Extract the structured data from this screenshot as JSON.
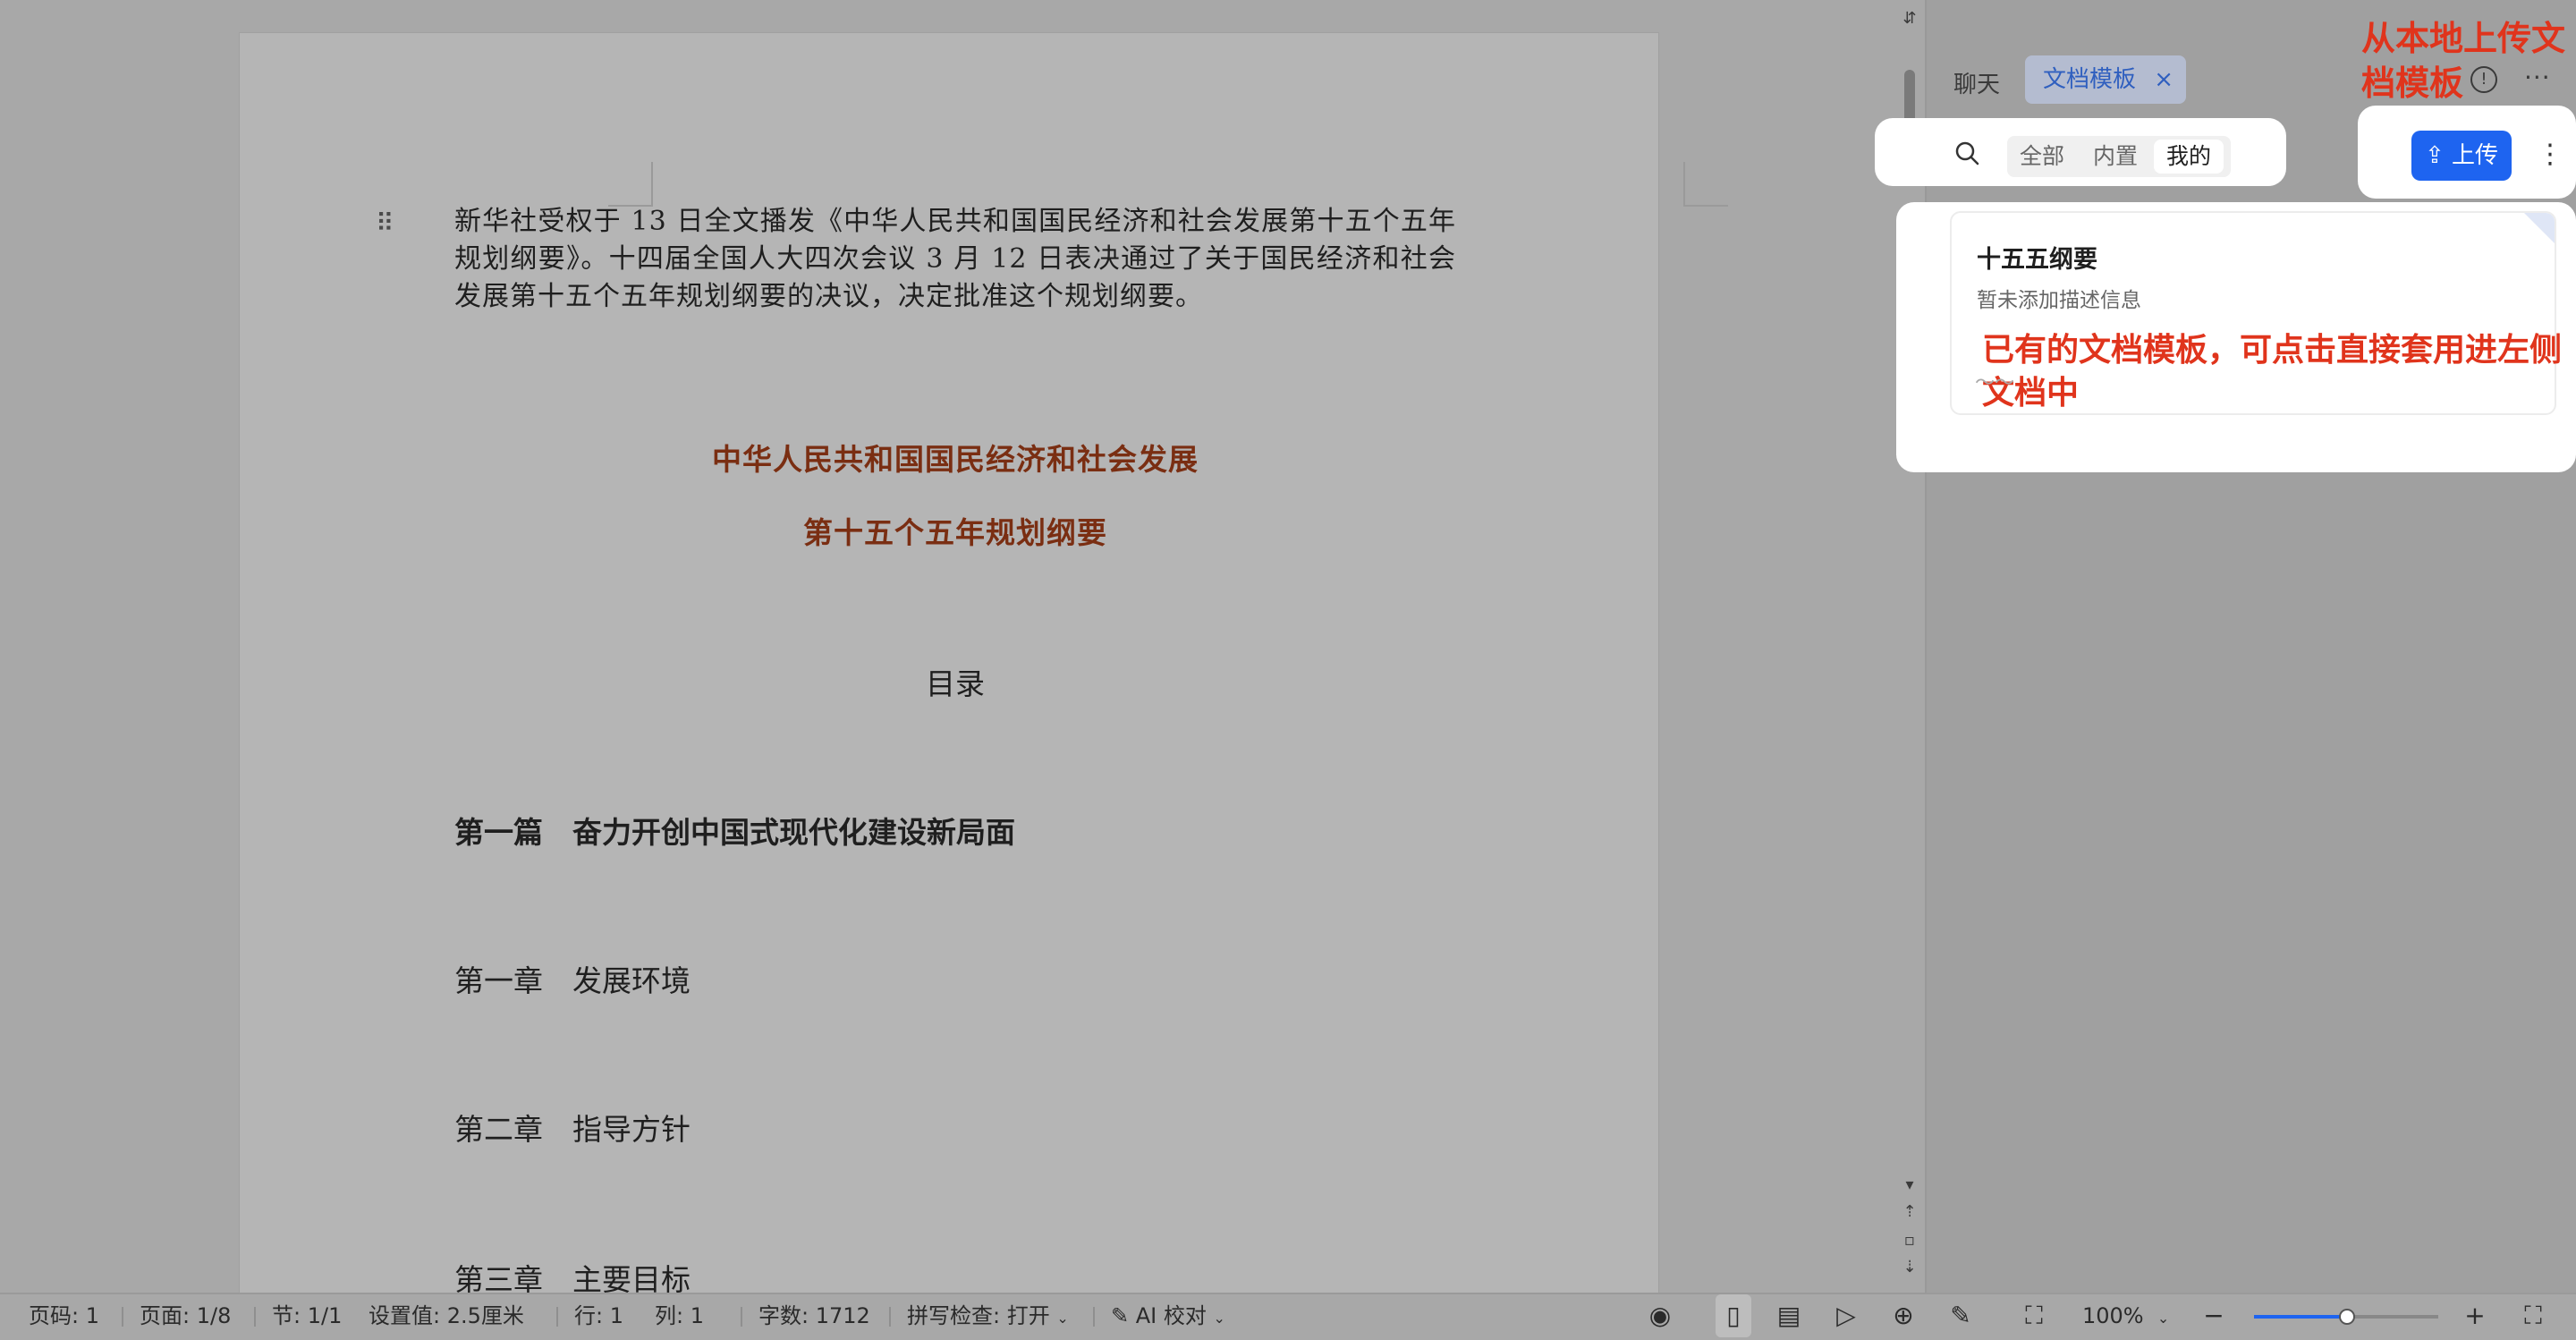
{
  "document": {
    "intro": "新华社受权于 13 日全文播发《中华人民共和国国民经济和社会发展第十五个五年规划纲要》。十四届全国人大四次会议 3 月 12 日表决通过了关于国民经济和社会发展第十五个五年规划纲要的决议，决定批准这个规划纲要。",
    "title_line1": "中华人民共和国国民经济和社会发展",
    "title_line2": "第十五个五年规划纲要",
    "toc": "目录",
    "part1": "第一篇　奋力开创中国式现代化建设新局面",
    "chapter1": "第一章　发展环境",
    "chapter2": "第二章　指导方针",
    "chapter3": "第三章　主要目标"
  },
  "panel": {
    "tab_chat": "聊天",
    "tab_template": "文档模板",
    "filters": {
      "all": "全部",
      "builtin": "内置",
      "mine": "我的",
      "selected": "我的"
    },
    "upload_label": "上传",
    "template": {
      "title": "十五五纲要",
      "description": "暂未添加描述信息"
    }
  },
  "annotations": {
    "upload": "从本地上传文档模板",
    "list": "已有的文档模板，可点击直接套用进左侧文档中"
  },
  "status": {
    "page_code": "页码: 1",
    "page": "页面: 1/8",
    "section": "节: 1/1",
    "setting": "设置值: 2.5厘米",
    "row": "行: 1",
    "col": "列: 1",
    "word_count": "字数: 1712",
    "spell_check": "拼写检查: 打开",
    "ai_proof": "AI 校对",
    "zoom": "100%",
    "zoom_level": 0.5
  },
  "colors": {
    "accent": "#1e64f0",
    "annotation": "#e0341c",
    "doc_heading": "#7a2e12"
  }
}
